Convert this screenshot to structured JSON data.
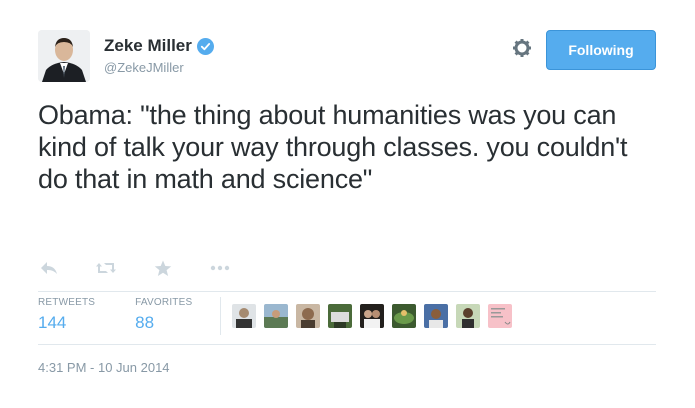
{
  "user": {
    "display_name": "Zeke Miller",
    "handle": "@ZekeJMiller",
    "verified": true
  },
  "follow_button": {
    "label": "Following"
  },
  "tweet": {
    "text": "Obama: \"the thing about humanities was you can kind of talk your way through classes. you couldn't do that in math and science\""
  },
  "actions": [
    "reply-icon",
    "retweet-icon",
    "favorite-icon",
    "more-icon"
  ],
  "stats": {
    "retweets_label": "RETWEETS",
    "retweets_count": "144",
    "favorites_label": "FAVORITES",
    "favorites_count": "88"
  },
  "favoriters_count_shown": 9,
  "timestamp": "4:31 PM - 10 Jun 2014",
  "colors": {
    "accent": "#55acee",
    "text": "#292f33",
    "muted": "#8899a6",
    "divider": "#e1e8ed"
  }
}
